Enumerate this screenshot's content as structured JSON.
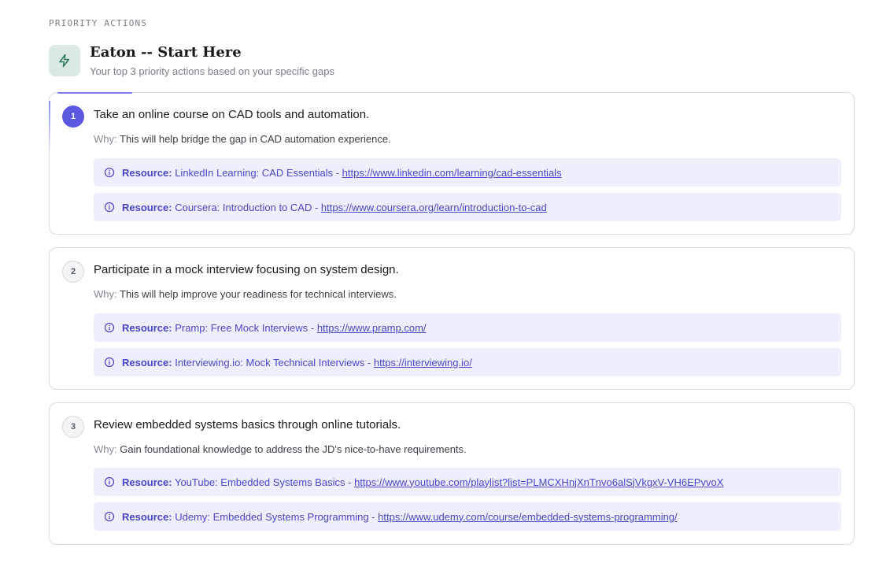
{
  "section_label": "PRIORITY ACTIONS",
  "header": {
    "icon": "lightning-icon",
    "title": "Eaton -- Start Here",
    "subtitle": "Your top 3 priority actions based on your specific gaps"
  },
  "colors": {
    "accent": "#5b57e0",
    "resource_bg": "#eeeffc",
    "icon_badge_bg": "#dbe9e3",
    "icon_stroke": "#2f7a5c"
  },
  "actions": [
    {
      "number": "1",
      "title": "Take an online course on CAD tools and automation.",
      "why_label": "Why:",
      "why_text": "This will help bridge the gap in CAD automation experience.",
      "resources": [
        {
          "label": "Resource:",
          "name": "LinkedIn Learning: CAD Essentials - ",
          "url": "https://www.linkedin.com/learning/cad-essentials"
        },
        {
          "label": "Resource:",
          "name": "Coursera: Introduction to CAD - ",
          "url": "https://www.coursera.org/learn/introduction-to-cad"
        }
      ]
    },
    {
      "number": "2",
      "title": "Participate in a mock interview focusing on system design.",
      "why_label": "Why:",
      "why_text": "This will help improve your readiness for technical interviews.",
      "resources": [
        {
          "label": "Resource:",
          "name": "Pramp: Free Mock Interviews - ",
          "url": "https://www.pramp.com/"
        },
        {
          "label": "Resource:",
          "name": "Interviewing.io: Mock Technical Interviews - ",
          "url": "https://interviewing.io/"
        }
      ]
    },
    {
      "number": "3",
      "title": "Review embedded systems basics through online tutorials.",
      "why_label": "Why:",
      "why_text": "Gain foundational knowledge to address the JD's nice-to-have requirements.",
      "resources": [
        {
          "label": "Resource:",
          "name": "YouTube: Embedded Systems Basics - ",
          "url": "https://www.youtube.com/playlist?list=PLMCXHnjXnTnvo6alSjVkgxV-VH6EPyvoX"
        },
        {
          "label": "Resource:",
          "name": "Udemy: Embedded Systems Programming - ",
          "url": "https://www.udemy.com/course/embedded-systems-programming/"
        }
      ]
    }
  ]
}
